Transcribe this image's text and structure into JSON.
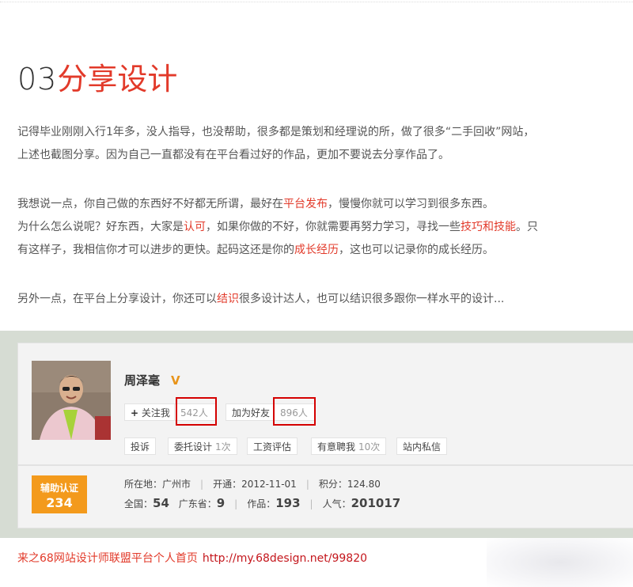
{
  "section": {
    "number": "03",
    "title": "分享设计"
  },
  "p1": {
    "line1": "记得毕业刚刚入行1年多，没人指导，也没帮助，很多都是策划和经理说的所，做了很多“二手回收”网站，",
    "line2": "上述也截图分享。因为自己一直都没有在平台看过好的作品，更加不要说去分享作品了。"
  },
  "p2": {
    "l1a": "我想说一点，你自己做的东西好不好都无所谓，最好在",
    "l1b": "平台发布",
    "l1c": "，慢慢你就可以学习到很多东西。",
    "l2a": "为什么怎么说呢？好东西，大家是",
    "l2b": "认可",
    "l2c": "，如果你做的不好，你就需要再努力学习，寻找一些",
    "l2d": "技巧和技能",
    "l2e": "。只",
    "l3a": "有这样子，我相信你才可以进步的更快。起码这还是你的",
    "l3b": "成长经历",
    "l3c": "，这也可以记录你的成长经历。"
  },
  "p3": {
    "a": "另外一点，在平台上分享设计，你还可以",
    "b": "结识",
    "c": "很多设计达人，也可以结识很多跟你一样水平的设计..."
  },
  "profile": {
    "name": "周泽毫",
    "verified_icon": "V",
    "follow": {
      "icon": "+",
      "label": "关注我",
      "count": "542人"
    },
    "friend": {
      "label": "加为好友",
      "count": "896人"
    },
    "actions": [
      {
        "label": "投诉",
        "count": ""
      },
      {
        "label": "委托设计",
        "count": "1次"
      },
      {
        "label": "工资评估",
        "count": ""
      },
      {
        "label": "有意聘我",
        "count": "10次"
      },
      {
        "label": "站内私信",
        "count": ""
      }
    ],
    "badge": {
      "title": "辅助认证",
      "value": "234"
    },
    "location": "所在地：广州市",
    "opened": "开通：2012-11-01",
    "points": "积分：124.80",
    "national_label": "全国：",
    "national": "54",
    "province_label": "广东省：",
    "province": "9",
    "works_label": "作品：",
    "works": "193",
    "popularity_label": "人气：",
    "popularity": "201017"
  },
  "footer": {
    "text": "来之68网站设计师联盟平台个人首页",
    "url": "http://my.68design.net/99820"
  },
  "colors": {
    "accent": "#e23a2a",
    "badge": "#f39a1c",
    "highlight_box": "#d40000"
  }
}
